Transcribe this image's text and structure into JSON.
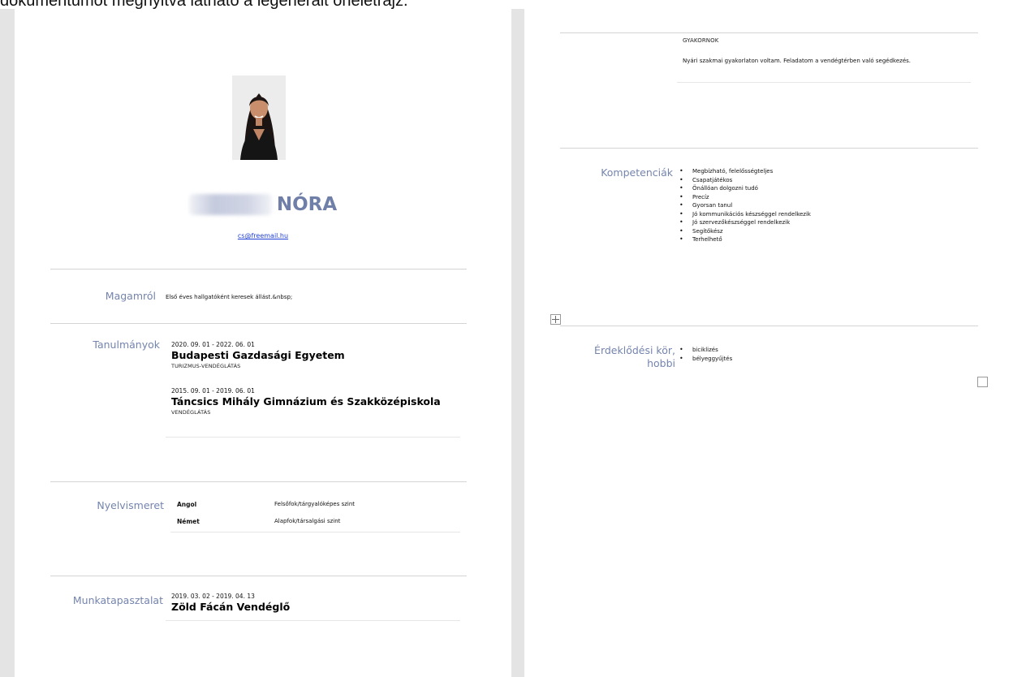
{
  "caption": "dokumentumot megnyitva látható a legenerált önéletrajz.",
  "header": {
    "photo_alt": "profile-photo",
    "name": "NÓRA",
    "email": "cs@freemail.hu"
  },
  "sections": {
    "magamrol": {
      "label": "Magamról",
      "text": "Első éves hallgatóként keresek állást.&nbsp;"
    },
    "tanulmanyok": {
      "label": "Tanulmányok",
      "entries": [
        {
          "dates": "2020. 09. 01 - 2022. 06. 01",
          "school": "Budapesti Gazdasági Egyetem",
          "field": "TURIZMUS-VENDÉGLÁTÁS"
        },
        {
          "dates": "2015. 09. 01 - 2019. 06. 01",
          "school": "Táncsics Mihály Gimnázium és Szakközépiskola",
          "field": "VENDÉGLÁTÁS"
        }
      ]
    },
    "nyelvismeret": {
      "label": "Nyelvismeret",
      "languages": [
        {
          "lang": "Angol",
          "level": "Felsőfok/tárgyalóképes szint"
        },
        {
          "lang": "Német",
          "level": "Alapfok/társalgási szint"
        }
      ]
    },
    "munkatapasztalat": {
      "label": "Munkatapasztalat",
      "dates": "2019. 03. 02 - 2019. 04. 13",
      "employer": "Zöld Fácán Vendéglő",
      "role": "GYAKORNOK",
      "description": "Nyári szakmai gyakorlaton voltam. Feladatom a vendégtérben való segédkezés."
    },
    "kompetenciak": {
      "label": "Kompetenciák",
      "items": [
        "Megbízható, felelősségteljes",
        "Csapatjátékos",
        "Önállóan dolgozni tudó",
        "Precíz",
        "Gyorsan tanul",
        "Jó kommunikációs készséggel rendelkezik",
        "Jó szervezőkészséggel rendelkezik",
        "Segítőkész",
        "Terhelhető"
      ]
    },
    "erdeklodes": {
      "label_line1": "Érdeklődési kör,",
      "label_line2": "hobbi",
      "items": [
        "biciklizés",
        "bélyeggyűjtés"
      ]
    }
  }
}
